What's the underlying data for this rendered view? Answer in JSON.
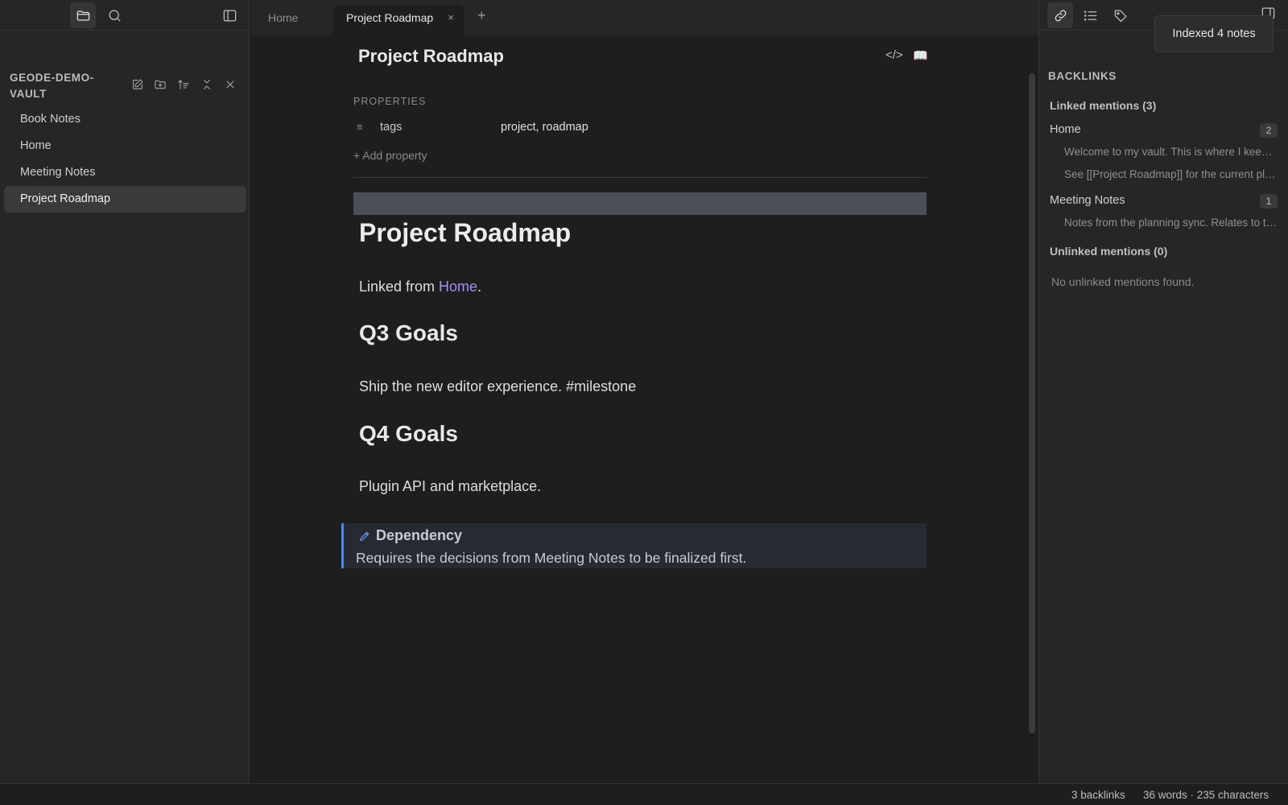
{
  "left_sidebar": {
    "vault_name": "GEODE-DEMO-VAULT",
    "files": [
      "Book Notes",
      "Home",
      "Meeting Notes",
      "Project Roadmap"
    ],
    "active_file": "Project Roadmap",
    "icons": [
      "folder-icon",
      "search-icon",
      "sidebar-toggle-icon",
      "new-note-icon",
      "new-folder-icon",
      "sort-icon",
      "collapse-icon",
      "close-icon"
    ]
  },
  "tabs": {
    "items": [
      {
        "label": "Home"
      },
      {
        "label": "Project Roadmap",
        "close": "×"
      }
    ],
    "new_tab": "+"
  },
  "editor": {
    "title": "Project Roadmap",
    "source_icon": "</>",
    "reading_icon": "📖",
    "properties_label": "PROPERTIES",
    "property": {
      "icon": "≡",
      "key": "tags",
      "value": "project, roadmap"
    },
    "add_property": "+ Add property",
    "h1": "Project Roadmap",
    "linked_prefix": "Linked from ",
    "linked_link": "Home",
    "linked_suffix": ".",
    "q3_heading": "Q3 Goals",
    "q3_text": "Ship the new editor experience. #milestone",
    "q4_heading": "Q4 Goals",
    "q4_text": "Plugin API and marketplace.",
    "callout": {
      "title": "Dependency",
      "body": "Requires the decisions from Meeting Notes to be finalized first.",
      "color": "#448aff"
    }
  },
  "right_sidebar": {
    "toast": "Indexed 4 notes",
    "heading": "BACKLINKS",
    "linked_mentions": "Linked mentions (3)",
    "notes": [
      {
        "name": "Home",
        "count": "2",
        "snippets": [
          "Welcome to my vault. This is where I keep my notes.",
          "See [[Project Roadmap]] for the current plan."
        ]
      },
      {
        "name": "Meeting Notes",
        "count": "1",
        "snippets": [
          "Notes from the planning sync. Relates to the roadmap."
        ]
      }
    ],
    "unlinked_mentions": "Unlinked mentions (0)",
    "empty_text": "No unlinked mentions found.",
    "icons": [
      "link-icon",
      "outline-icon",
      "tags-icon",
      "right-sidebar-toggle-icon"
    ]
  },
  "status": {
    "backlinks": "3 backlinks",
    "counts": "36 words · 235 characters"
  },
  "colors": {
    "accent_link": "#a88bfa",
    "callout_border": "#448aff"
  }
}
